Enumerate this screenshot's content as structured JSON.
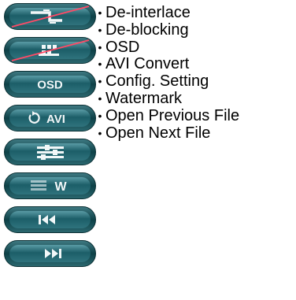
{
  "colors": {
    "pill_outer": "#0d4147",
    "pill_outer_light": "#3f7a83",
    "pill_face": "#1c5e68",
    "pill_face_light": "#4f919b",
    "glyph": "#f2f7f8",
    "strike": "#ff4a66"
  },
  "buttons": [
    {
      "name": "de-interlace",
      "icon": "de-interlace-icon",
      "label": "",
      "struck": true
    },
    {
      "name": "de-blocking",
      "icon": "de-blocking-icon",
      "label": "",
      "struck": true
    },
    {
      "name": "osd",
      "icon": "osd-icon",
      "label": "OSD",
      "struck": false
    },
    {
      "name": "avi-convert",
      "icon": "avi-convert-icon",
      "label": "AVI",
      "struck": false
    },
    {
      "name": "config-setting",
      "icon": "config-setting-icon",
      "label": "",
      "struck": false
    },
    {
      "name": "watermark",
      "icon": "watermark-icon",
      "label": "W",
      "struck": false
    },
    {
      "name": "open-previous-file",
      "icon": "previous-file-icon",
      "label": "",
      "struck": false
    },
    {
      "name": "open-next-file",
      "icon": "next-file-icon",
      "label": "",
      "struck": false
    }
  ],
  "features": {
    "bullet": "•",
    "items": [
      "De-interlace",
      "De-blocking",
      "OSD",
      "AVI Convert",
      "Config. Setting",
      "Watermark",
      "Open Previous File",
      "Open Next File"
    ]
  }
}
